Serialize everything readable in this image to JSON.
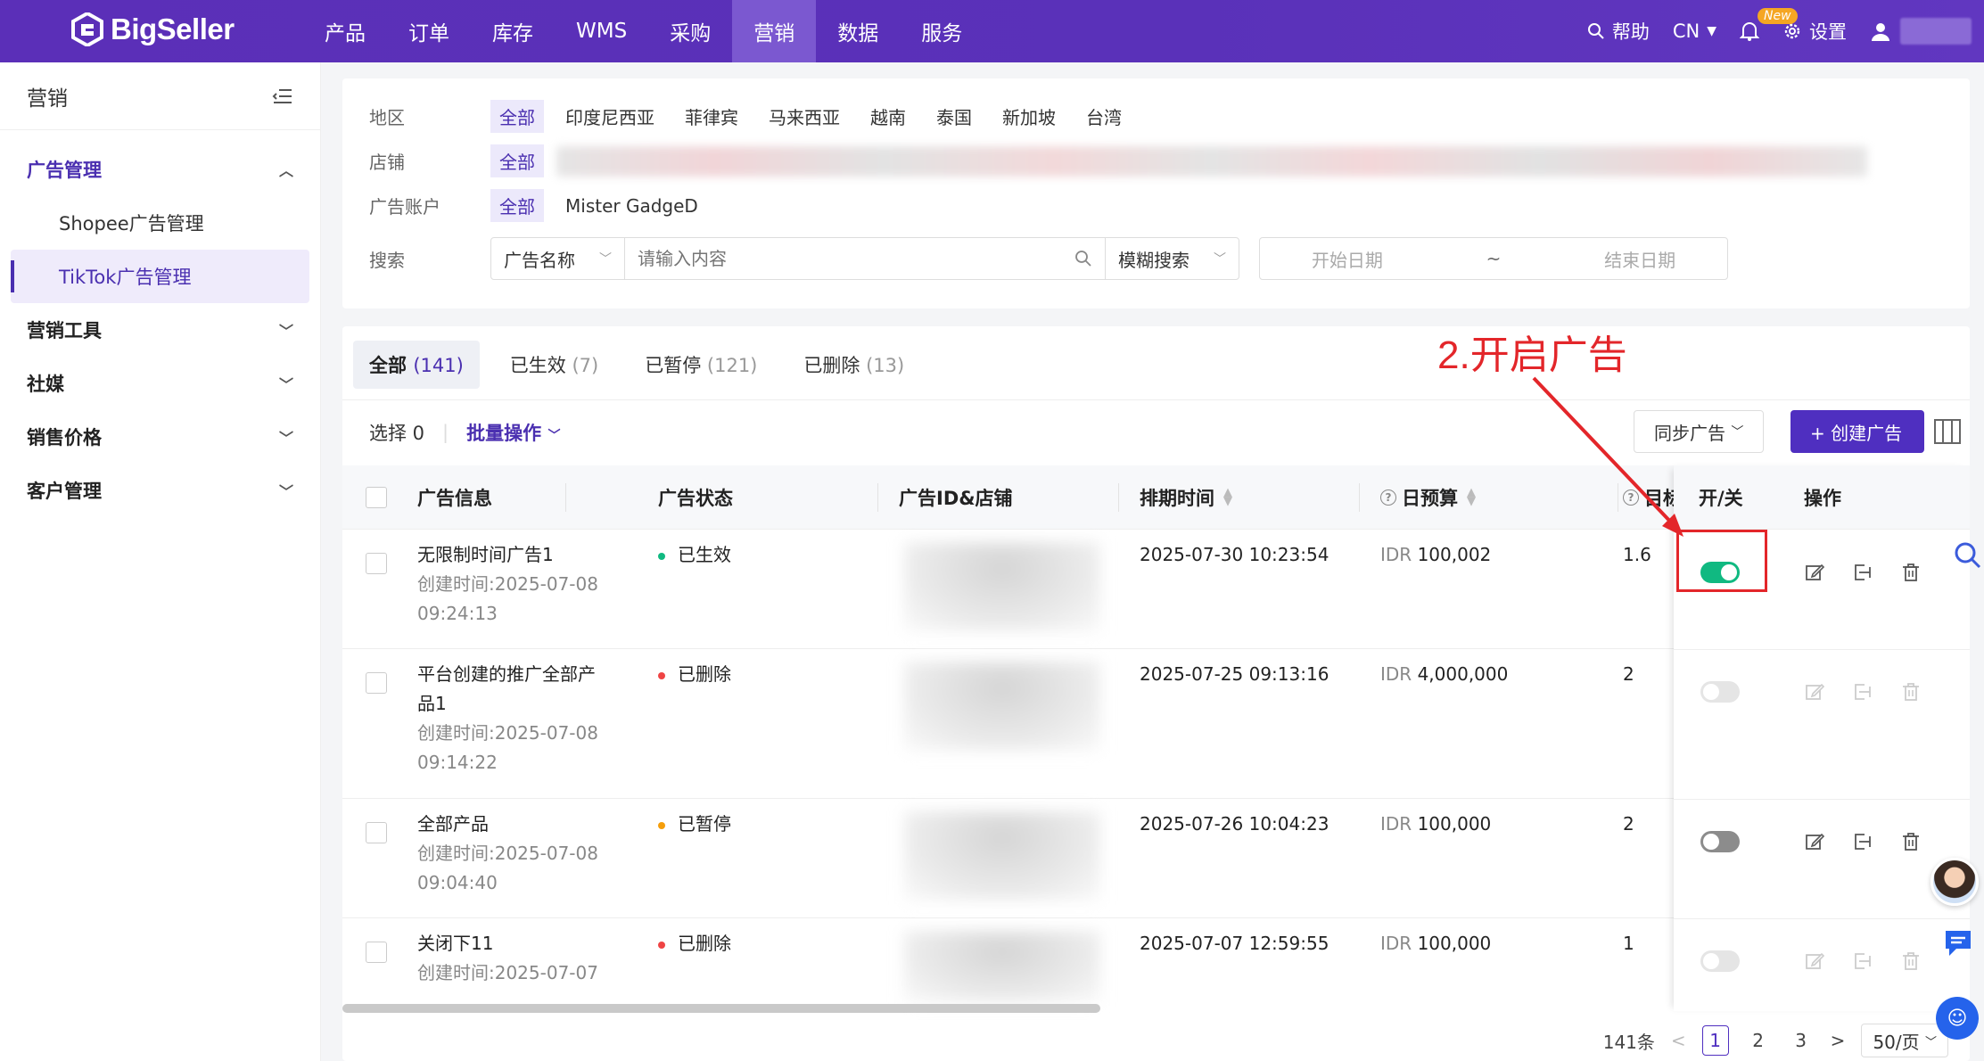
{
  "brand": "BigSeller",
  "nav": [
    "产品",
    "订单",
    "库存",
    "WMS",
    "采购",
    "营销",
    "数据",
    "服务"
  ],
  "nav_active": "营销",
  "topright": {
    "help": "帮助",
    "lang": "CN",
    "new_badge": "New",
    "settings": "设置"
  },
  "sidebar": {
    "title": "营销",
    "groups": [
      {
        "label": "广告管理",
        "open": true,
        "items": [
          "Shopee广告管理",
          "TikTok广告管理"
        ]
      },
      {
        "label": "营销工具"
      },
      {
        "label": "社媒"
      },
      {
        "label": "销售价格"
      },
      {
        "label": "客户管理"
      }
    ],
    "active_item": "TikTok广告管理"
  },
  "filter": {
    "region_label": "地区",
    "regions": [
      "全部",
      "印度尼西亚",
      "菲律宾",
      "马来西亚",
      "越南",
      "泰国",
      "新加坡",
      "台湾"
    ],
    "shop_label": "店铺",
    "shop_all": "全部",
    "account_label": "广告账户",
    "account_all": "全部",
    "account": "Mister GadgeD",
    "search_label": "搜索",
    "search_field": "广告名称",
    "search_placeholder": "请输入内容",
    "search_mode": "模糊搜索",
    "start_date": "开始日期",
    "date_sep": "~",
    "end_date": "结束日期"
  },
  "tabs": [
    {
      "label": "全部",
      "count": "(141)"
    },
    {
      "label": "已生效",
      "count": "(7)"
    },
    {
      "label": "已暂停",
      "count": "(121)"
    },
    {
      "label": "已删除",
      "count": "(13)"
    }
  ],
  "toolbar": {
    "select": "选择 0",
    "bulk": "批量操作",
    "sync": "同步广告",
    "create": "+ 创建广告"
  },
  "annotation": "2.开启广告",
  "columns": {
    "info": "广告信息",
    "status": "广告状态",
    "id_shop": "广告ID&店铺",
    "schedule": "排期时间",
    "budget": "日预算",
    "target": "目标",
    "toggle": "开/关",
    "ops": "操作"
  },
  "rows": [
    {
      "name": "无限制时间广告1",
      "created": "创建时间:2025-07-08",
      "created2": "09:24:13",
      "status": "已生效",
      "status_color": "#10b981",
      "schedule": "2025-07-30 10:23:54",
      "currency": "IDR",
      "budget": "100,002",
      "target": "1.6",
      "on": true
    },
    {
      "name": "平台创建的推广全部产",
      "name2": "品1",
      "created": "创建时间:2025-07-08",
      "created2": "09:14:22",
      "status": "已删除",
      "status_color": "#ef4444",
      "schedule": "2025-07-25 09:13:16",
      "currency": "IDR",
      "budget": "4,000,000",
      "target": "2",
      "on": false,
      "disabled": true
    },
    {
      "name": "全部产品",
      "created": "创建时间:2025-07-08",
      "created2": "09:04:40",
      "status": "已暂停",
      "status_color": "#f59e0b",
      "schedule": "2025-07-26 10:04:23",
      "currency": "IDR",
      "budget": "100,000",
      "target": "2",
      "on": false
    },
    {
      "name": "关闭下11",
      "created": "创建时间:2025-07-07",
      "status": "已删除",
      "status_color": "#ef4444",
      "schedule": "2025-07-07 12:59:55",
      "currency": "IDR",
      "budget": "100,000",
      "target": "1",
      "on": false,
      "disabled": true
    }
  ],
  "pager": {
    "total": "141条",
    "pages": [
      "1",
      "2",
      "3"
    ],
    "current": "1",
    "size": "50/页"
  }
}
